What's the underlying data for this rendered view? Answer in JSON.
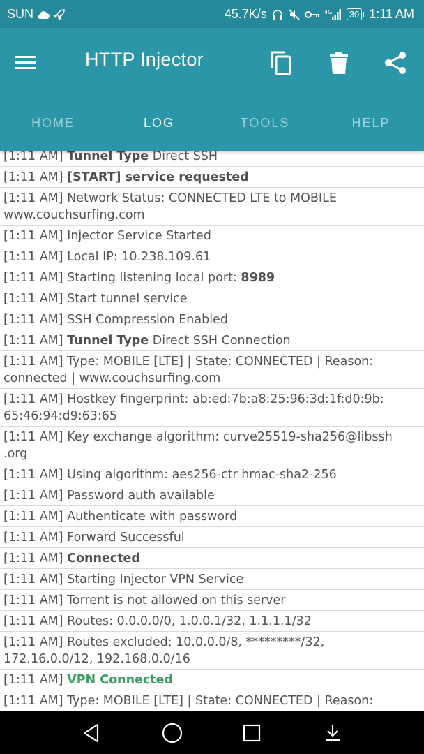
{
  "status_bar": {
    "carrier": "SUN",
    "speed": "45.7K/s",
    "network": "4G",
    "battery": "30",
    "time": "1:11 AM"
  },
  "app_bar": {
    "title": "HTTP Injector",
    "icons": [
      "menu-icon",
      "copy-icon",
      "delete-icon",
      "share-icon"
    ],
    "accent": "#2a96a8",
    "status_color": "#24899a"
  },
  "tabs": [
    {
      "label": "HOME",
      "active": false
    },
    {
      "label": "LOG",
      "active": true
    },
    {
      "label": "TOOLS",
      "active": false
    },
    {
      "label": "HELP",
      "active": false
    }
  ],
  "log": [
    {
      "time": "[1:11 AM]",
      "bold": "Tunnel Type",
      "text": " Direct SSH"
    },
    {
      "time": "[1:11 AM]",
      "bold": "[START] service requested",
      "text": ""
    },
    {
      "time": "[1:11 AM]",
      "bold": "",
      "text": "Network Status: CONNECTED LTE to MOBILE www.couchsurfing.com"
    },
    {
      "time": "[1:11 AM]",
      "bold": "",
      "text": "Injector Service Started"
    },
    {
      "time": "[1:11 AM]",
      "bold": "",
      "text": "Local IP: 10.238.109.61"
    },
    {
      "time": "[1:11 AM]",
      "bold": "",
      "text": "Starting listening local port: ",
      "bold_after": "8989"
    },
    {
      "time": "[1:11 AM]",
      "bold": "",
      "text": "Start tunnel service"
    },
    {
      "time": "[1:11 AM]",
      "bold": "",
      "text": "SSH Compression Enabled"
    },
    {
      "time": "[1:11 AM]",
      "bold": "Tunnel Type",
      "text": " Direct SSH Connection"
    },
    {
      "time": "[1:11 AM]",
      "bold": "",
      "text": "Type: MOBILE [LTE] | State: CONNECTED | Reason: connected | www.couchsurfing.com"
    },
    {
      "time": "[1:11 AM]",
      "bold": "",
      "text": "Hostkey fingerprint: ab:ed:7b:a8:25:96:3d:1f:d0:9b:\n65:46:94:d9:63:65"
    },
    {
      "time": "[1:11 AM]",
      "bold": "",
      "text": "Key exchange algorithm: curve25519-sha256@libssh\n.org"
    },
    {
      "time": "[1:11 AM]",
      "bold": "",
      "text": "Using algorithm: aes256-ctr hmac-sha2-256"
    },
    {
      "time": "[1:11 AM]",
      "bold": "",
      "text": "Password auth available"
    },
    {
      "time": "[1:11 AM]",
      "bold": "",
      "text": "Authenticate with password"
    },
    {
      "time": "[1:11 AM]",
      "bold": "",
      "text": "Forward Successful"
    },
    {
      "time": "[1:11 AM]",
      "bold": "Connected",
      "text": ""
    },
    {
      "time": "[1:11 AM]",
      "bold": "",
      "text": "Starting Injector VPN Service"
    },
    {
      "time": "[1:11 AM]",
      "bold": "",
      "text": "Torrent is not allowed on this server"
    },
    {
      "time": "[1:11 AM]",
      "bold": "",
      "text": "Routes: 0.0.0.0/0, 1.0.0.1/32, 1.1.1.1/32"
    },
    {
      "time": "[1:11 AM]",
      "bold": "",
      "text": "Routes excluded: 10.0.0.0/8, *********/32,\n172.16.0.0/12, 192.168.0.0/16"
    },
    {
      "time": "[1:11 AM]",
      "bold": "VPN Connected",
      "text": "",
      "highlight": "#3d9e62"
    },
    {
      "time": "[1:11 AM]",
      "bold": "",
      "text": "Type: MOBILE [LTE] | State: CONNECTED | Reason: connected | www.couchsurfing.com"
    }
  ],
  "nav_bar": {
    "icons": [
      "back-icon",
      "home-icon",
      "recent-apps-icon",
      "notification-drawer-icon"
    ]
  }
}
